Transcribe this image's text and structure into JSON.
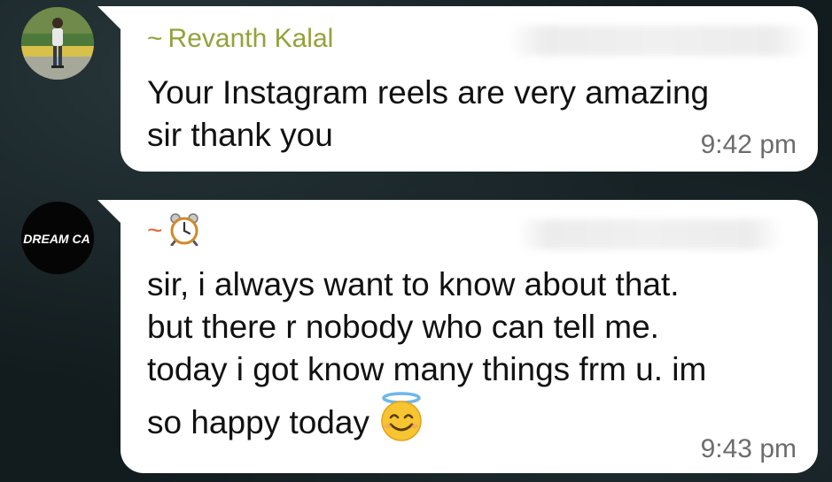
{
  "messages": [
    {
      "sender": {
        "prefix": "~",
        "name": "Revanth Kalal",
        "color": "#93a13a"
      },
      "avatar": {
        "icon": "profile-photo-person"
      },
      "lines": [
        "Your Instagram reels are very amazing",
        "sir thank you"
      ],
      "time": "9:42 pm"
    },
    {
      "sender": {
        "prefix": "~",
        "name": "",
        "color": "#e0683a",
        "icon": "alarm-clock-emoji"
      },
      "avatar": {
        "label": "DREAM CA"
      },
      "lines": [
        "sir, i always want to know about that.",
        "but there r nobody who can tell me.",
        "today i got know many things frm u. im",
        "so happy today"
      ],
      "emoji": "smiling-face-with-halo",
      "time": "9:43 pm"
    }
  ]
}
